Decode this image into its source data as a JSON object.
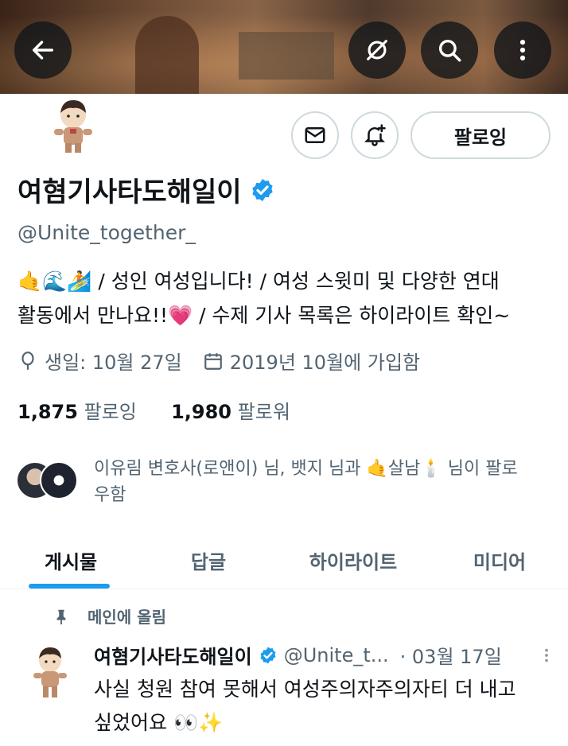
{
  "header": {
    "back_icon": "back-arrow-icon",
    "grok_icon": "slash-circle-icon",
    "search_icon": "search-icon",
    "more_icon": "more-vertical-icon"
  },
  "profile": {
    "name": "여혐기사타도해일이",
    "handle": "@Unite_together_",
    "bio_line1": "🤙🌊🏄 / 성인 여성입니다! / 여성 스윗미 및 다양한 연대",
    "bio_line2": "활동에서 만나요!!💗 / 수제 기사 목록은 하이라이트 확인~",
    "birthday": "생일: 10월 27일",
    "joined": "2019년 10월에 가입함",
    "following_count": "1,875",
    "following_label": "팔로잉",
    "followers_count": "1,980",
    "followers_label": "팔로워",
    "followed_by": "이유림 변호사(로앤이) 님, 뱃지 님과 🤙살남🕯️ 님이 팔로우함",
    "verified_color": "#1d9bf0"
  },
  "actions": {
    "follow_label": "팔로잉"
  },
  "tabs": [
    {
      "label": "게시물",
      "active": true
    },
    {
      "label": "답글"
    },
    {
      "label": "하이라이트"
    },
    {
      "label": "미디어"
    }
  ],
  "post": {
    "pinned_label": "메인에 올림",
    "author_name": "여혐기사타도해일이",
    "author_handle": "@Unite_t...",
    "date": "· 03월 17일",
    "text": "사실 청원 참여 못해서 여성주의자주의자티 더 내고 싶었어요 👀✨"
  }
}
